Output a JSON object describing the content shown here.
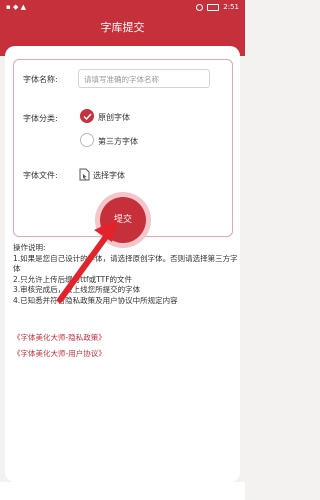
{
  "status_bar": {
    "time": "2:51"
  },
  "header": {
    "title": "字库提交"
  },
  "form": {
    "font_name_label": "字体名称:",
    "font_name_placeholder": "请填写准确的字体名称",
    "category_label": "字体分类:",
    "options": [
      {
        "label": "原创字体",
        "checked": true
      },
      {
        "label": "第三方字体",
        "checked": false
      }
    ],
    "file_label": "字体文件:",
    "file_button": "选择字体",
    "submit": "提交"
  },
  "instructions": {
    "title": "操作说明:",
    "lines": [
      "1.如果是您自己设计的字体，请选择原创字体。否则请选择第三方字体",
      "2.只允许上传后缀为ttf或TTF的文件",
      "3.审核完成后，会上线您所提交的字体",
      "4.已知悉并符合隐私政策及用户协议中所规定内容"
    ]
  },
  "links": [
    "《字体美化大师-隐私政策》",
    "《字体美化大师-用户协议》"
  ],
  "colors": {
    "accent": "#c5303a"
  }
}
